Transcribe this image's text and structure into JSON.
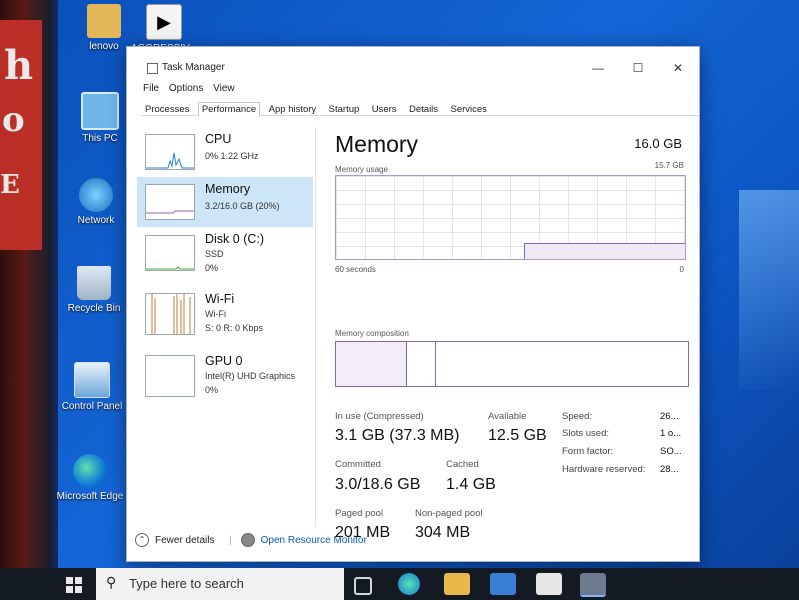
{
  "desktop": {
    "icons": [
      {
        "label": "lenovo"
      },
      {
        "label": "AGGRESSIV..."
      },
      {
        "label": "This PC"
      },
      {
        "label": "Network"
      },
      {
        "label": "Recycle Bin"
      },
      {
        "label": "Control Panel"
      },
      {
        "label": "Microsoft Edge"
      }
    ]
  },
  "window": {
    "title": "Task Manager",
    "menu": [
      "File",
      "Options",
      "View"
    ],
    "tabs": [
      "Processes",
      "Performance",
      "App history",
      "Startup",
      "Users",
      "Details",
      "Services"
    ],
    "active_tab": "Performance"
  },
  "resources": [
    {
      "name": "CPU",
      "sub1": "0% 1.22 GHz",
      "sub2": ""
    },
    {
      "name": "Memory",
      "sub1": "3.2/16.0 GB (20%)",
      "sub2": ""
    },
    {
      "name": "Disk 0 (C:)",
      "sub1": "SSD",
      "sub2": "0%"
    },
    {
      "name": "Wi-Fi",
      "sub1": "Wi-Fi",
      "sub2": "S: 0 R: 0 Kbps"
    },
    {
      "name": "GPU 0",
      "sub1": "Intel(R) UHD Graphics",
      "sub2": "0%"
    }
  ],
  "memory": {
    "title": "Memory",
    "total": "16.0 GB",
    "usage_label": "Memory usage",
    "usage_max": "15.7 GB",
    "x_left": "60 seconds",
    "x_right": "0",
    "composition_label": "Memory composition",
    "stats": {
      "in_use_label": "In use (Compressed)",
      "in_use": "3.1 GB (37.3 MB)",
      "available_label": "Available",
      "available": "12.5 GB",
      "committed_label": "Committed",
      "committed": "3.0/18.6 GB",
      "cached_label": "Cached",
      "cached": "1.4 GB",
      "paged_label": "Paged pool",
      "paged": "201 MB",
      "nonpaged_label": "Non-paged pool",
      "nonpaged": "304 MB"
    },
    "details": [
      {
        "label": "Speed:",
        "value": "26..."
      },
      {
        "label": "Slots used:",
        "value": "1 o..."
      },
      {
        "label": "Form factor:",
        "value": "SO..."
      },
      {
        "label": "Hardware reserved:",
        "value": "28..."
      }
    ],
    "usage_fraction": 0.2,
    "composition_fractions": [
      0.2,
      0.08,
      0.72
    ]
  },
  "footer": {
    "fewer_details": "Fewer details",
    "open_resource_monitor": "Open Resource Monitor"
  },
  "taskbar": {
    "search_placeholder": "Type here to search"
  },
  "colors": {
    "accent_memory": "#8b66b3",
    "selected_bg": "#cce6f7",
    "link": "#0b59b5"
  }
}
